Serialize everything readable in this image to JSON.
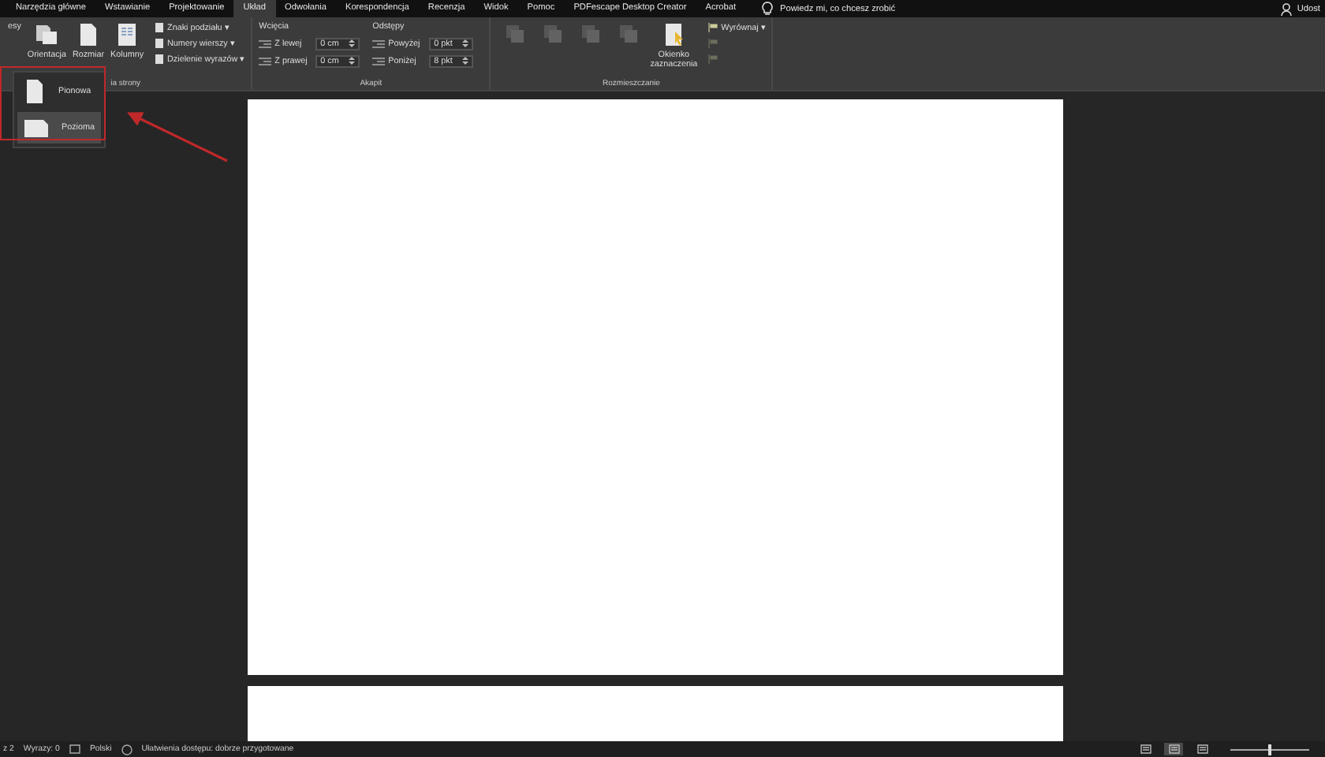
{
  "tabs": [
    {
      "label": "Narzędzia główne",
      "selected": false
    },
    {
      "label": "Wstawianie",
      "selected": false
    },
    {
      "label": "Projektowanie",
      "selected": false
    },
    {
      "label": "Układ",
      "selected": true
    },
    {
      "label": "Odwołania",
      "selected": false
    },
    {
      "label": "Korespondencja",
      "selected": false
    },
    {
      "label": "Recenzja",
      "selected": false
    },
    {
      "label": "Widok",
      "selected": false
    },
    {
      "label": "Pomoc",
      "selected": false
    },
    {
      "label": "PDFescape Desktop Creator",
      "selected": false
    },
    {
      "label": "Acrobat",
      "selected": false
    }
  ],
  "tell_me": "Powiedz mi, co chcesz zrobić",
  "share": "Udost",
  "page_setup": {
    "label": "ia strony",
    "big_buttons": [
      "esy",
      "Orientacja",
      "Rozmiar",
      "Kolumny"
    ],
    "small_buttons": [
      "Znaki podziału ▾",
      "Numery wierszy ▾",
      "Dzielenie wyrazów ▾"
    ]
  },
  "paragraph": {
    "label": "Akapit",
    "indent": {
      "title": "Wcięcia",
      "fields": [
        {
          "label": "Z lewej",
          "value": "0 cm"
        },
        {
          "label": "Z prawej",
          "value": "0 cm"
        }
      ]
    },
    "spacing": {
      "title": "Odstępy",
      "fields": [
        {
          "label": "Powyżej",
          "value": "0 pkt"
        },
        {
          "label": "Poniżej",
          "value": "8 pkt"
        }
      ]
    }
  },
  "arrange": {
    "label": "Rozmieszczanie",
    "buttons": [
      {
        "disabled": true
      },
      {
        "disabled": true
      },
      {
        "disabled": true
      },
      {
        "disabled": true
      },
      {
        "label": "Okienko zaznaczenia",
        "disabled": false
      }
    ],
    "small_buttons": [
      {
        "label": "Wyrównaj ▾",
        "disabled": false
      },
      {
        "disabled": true
      },
      {
        "disabled": true
      }
    ]
  },
  "orientation_menu": [
    {
      "label": "Pionowa",
      "kind": "portrait",
      "selected": false
    },
    {
      "label": "Pozioma",
      "kind": "landscape",
      "selected": true
    }
  ],
  "status_bar": {
    "page": "z 2",
    "words": "Wyrazy: 0",
    "language": "Polski",
    "accessibility": "Ułatwienia dostępu: dobrze przygotowane",
    "views": [
      {
        "selected": false
      },
      {
        "selected": true
      },
      {
        "selected": false
      }
    ],
    "zoom": {
      "level": 0.5
    }
  }
}
